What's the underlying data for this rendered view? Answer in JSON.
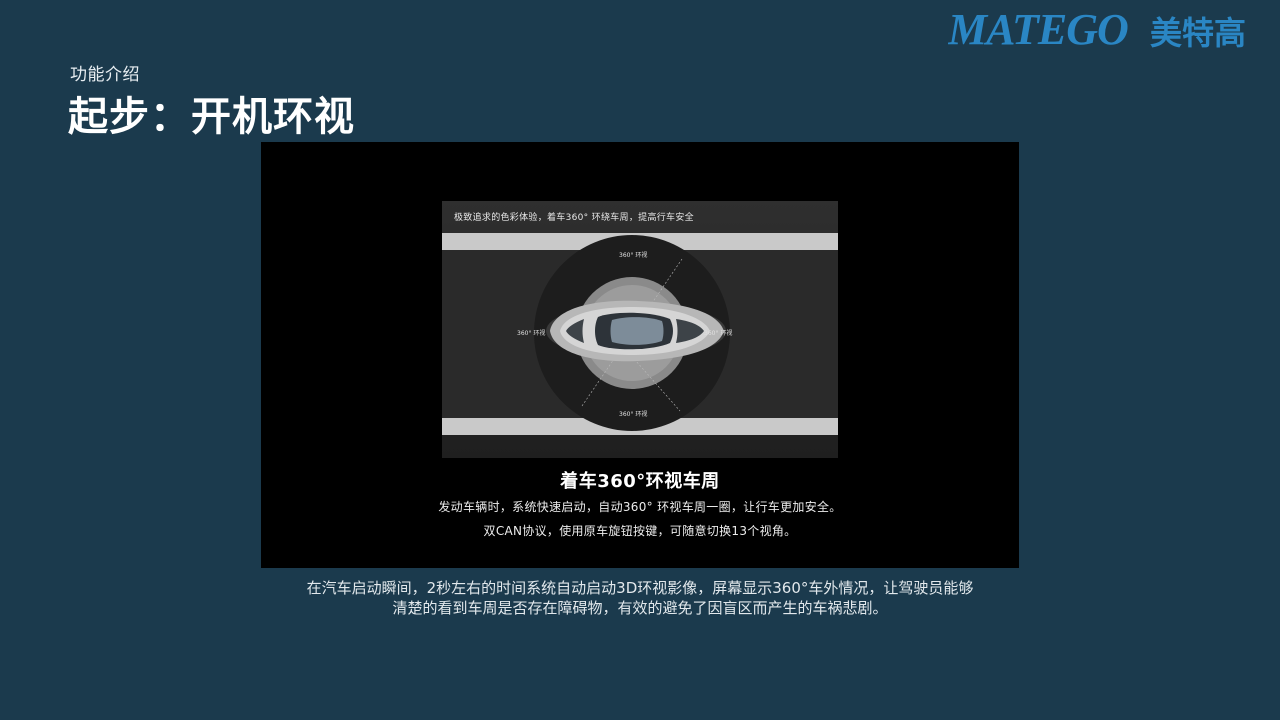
{
  "logo": {
    "latin_text": "MATEGO",
    "chinese_text": "美特高",
    "color": "#2a86c4"
  },
  "header": {
    "section_label": "功能介绍",
    "title": "起步：开机环视"
  },
  "panel": {
    "image": {
      "caption": "极致追求的色彩体验，着车360° 环绕车周，提高行车安全",
      "view_labels": {
        "top": "360° 环视",
        "left": "360° 环视",
        "right": "360° 环视",
        "bottom": "360° 环视"
      }
    },
    "heading": "着车360°环视车周",
    "line1": "发动车辆时，系统快速启动，自动360° 环视车周一圈，让行车更加安全。",
    "line2": "双CAN协议，使用原车旋钮按键，可随意切换13个视角。"
  },
  "description": {
    "line1": "在汽车启动瞬间，2秒左右的时间系统自动启动3D环视影像，屏幕显示360°车外情况，让驾驶员能够",
    "line2": "清楚的看到车周是否存在障碍物，有效的避免了因盲区而产生的车祸悲剧。"
  },
  "colors": {
    "background": "#1b3a4d",
    "panel": "#000000",
    "accent": "#2a86c4"
  }
}
